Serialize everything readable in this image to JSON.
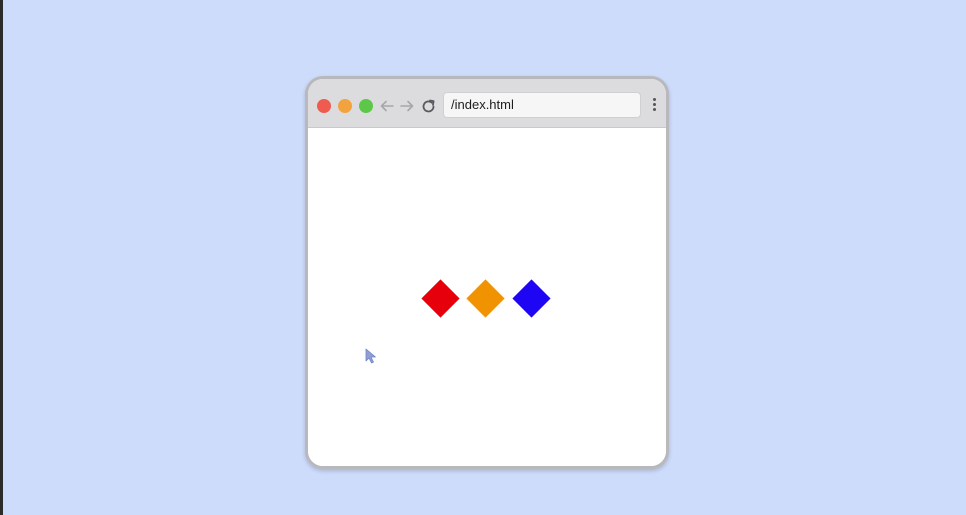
{
  "page": {
    "background": "#cddcfb"
  },
  "window": {
    "traffic_lights": {
      "close": "#f05b50",
      "minimize": "#f2a33d",
      "maximize": "#5dc74a"
    },
    "toolbar": {
      "back_icon": "arrow-left-icon",
      "forward_icon": "arrow-right-icon",
      "reload_icon": "reload-icon",
      "menu_icon": "kebab-menu-icon"
    },
    "address_bar": {
      "value": "/index.html"
    }
  },
  "content": {
    "shapes": [
      {
        "name": "red-diamond",
        "color": "#e6000b"
      },
      {
        "name": "orange-diamond",
        "color": "#f19200"
      },
      {
        "name": "blue-diamond",
        "color": "#1e06f4"
      }
    ],
    "cursor_icon": "pointer-cursor-icon"
  }
}
